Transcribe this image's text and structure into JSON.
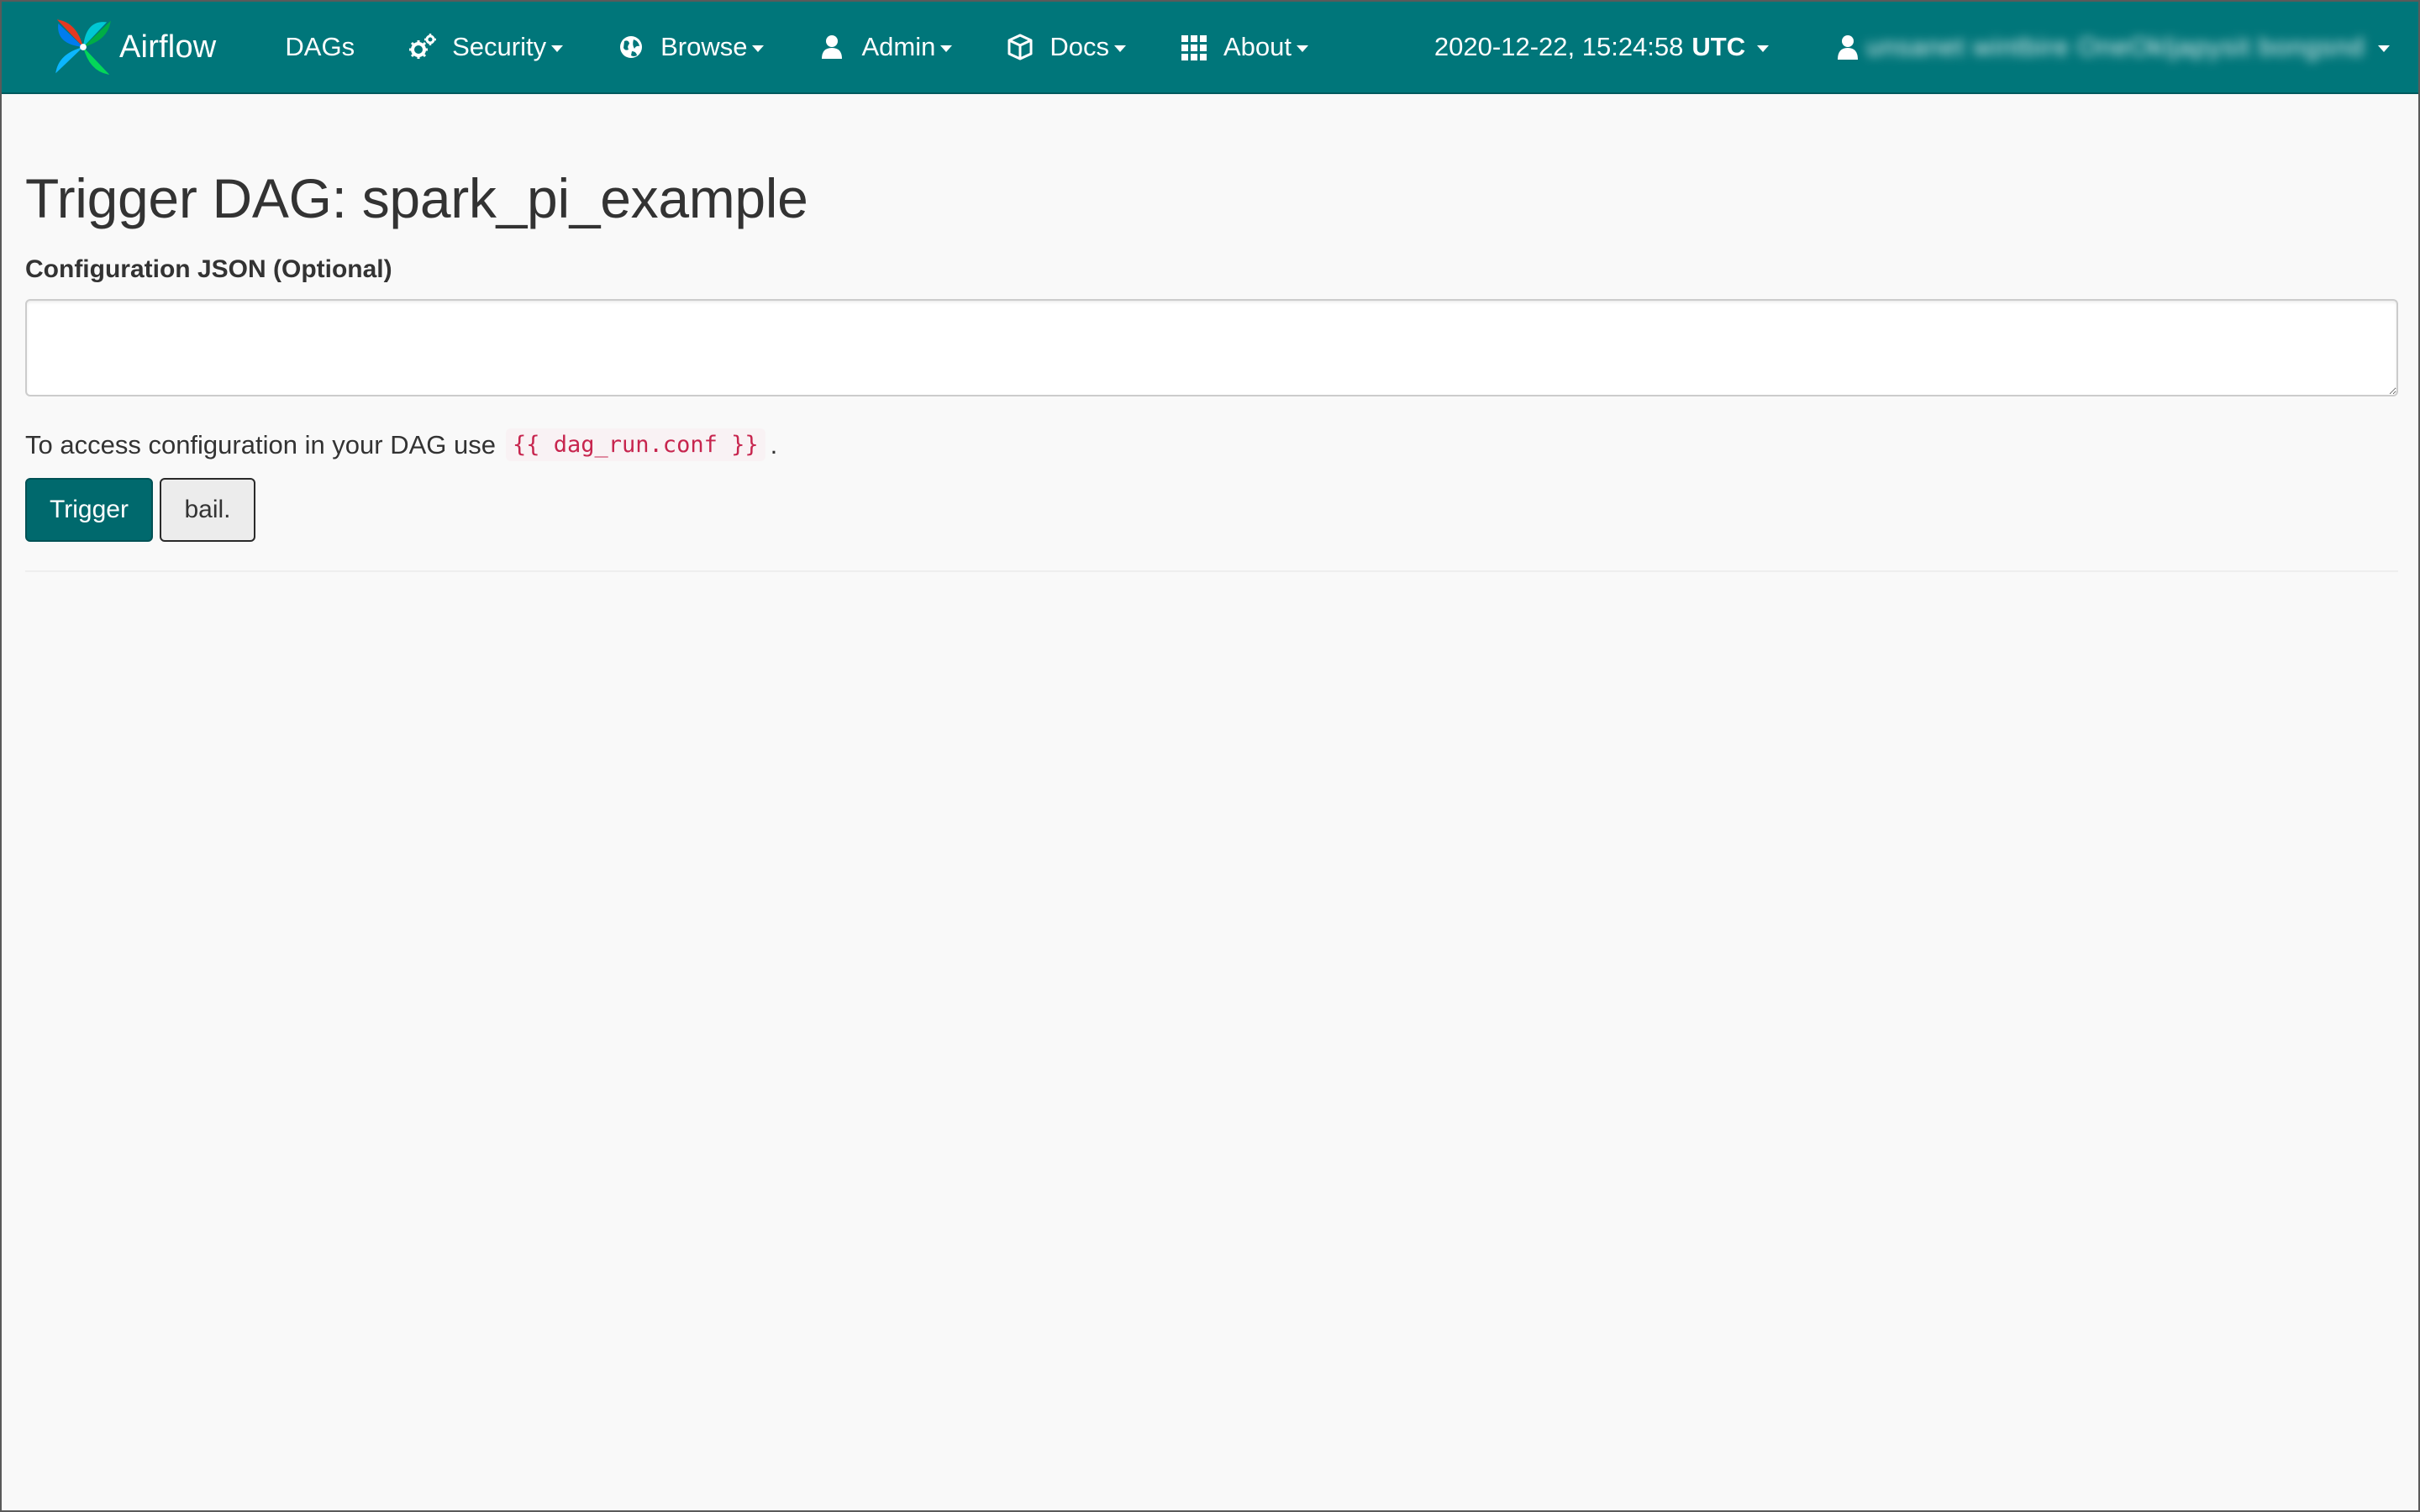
{
  "navbar": {
    "brand": "Airflow",
    "items": [
      {
        "label": "DAGs",
        "icon": "none",
        "dropdown": false
      },
      {
        "label": "Security",
        "icon": "gears-icon",
        "dropdown": true
      },
      {
        "label": "Browse",
        "icon": "globe-icon",
        "dropdown": true
      },
      {
        "label": "Admin",
        "icon": "user-icon",
        "dropdown": true
      },
      {
        "label": "Docs",
        "icon": "cube-icon",
        "dropdown": true
      },
      {
        "label": "About",
        "icon": "grid-icon",
        "dropdown": true
      }
    ],
    "clock": {
      "datetime": "2020-12-22, 15:24:58",
      "timezone": "UTC"
    },
    "user": {
      "name": "unsanet wintbire OneOkljapysit bongsnd",
      "icon": "user-icon"
    },
    "colors": {
      "background": "#00767a",
      "text": "#ffffff"
    }
  },
  "main": {
    "title": "Trigger DAG: spark_pi_example",
    "conf_label": "Configuration JSON (Optional)",
    "conf_value": "",
    "help_prefix": "To access configuration in your DAG use",
    "help_code": "{{ dag_run.conf }}",
    "help_suffix": ".",
    "trigger_label": "Trigger",
    "bail_label": "bail."
  },
  "colors": {
    "trigger_button": "#00696d",
    "code_text": "#c7254e",
    "code_background": "#f9f2f4",
    "page_background": "#f9f9f9"
  }
}
